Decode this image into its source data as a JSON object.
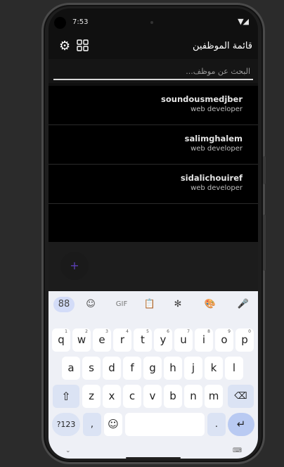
{
  "status_bar": {
    "time": "7:53",
    "signal": "▼◢"
  },
  "app_bar": {
    "title": "قائمة الموظفين",
    "settings_icon": "gear-icon",
    "grid_icon": "grid-icon"
  },
  "search": {
    "placeholder": "البحث عن موظف..."
  },
  "employees": [
    {
      "name": "soundousmedjber",
      "role": "web developer"
    },
    {
      "name": "salimghalem",
      "role": "web developer"
    },
    {
      "name": "sidalichouiref",
      "role": "web developer"
    }
  ],
  "fab": {
    "label": "+"
  },
  "keyboard": {
    "toolbar": [
      "88",
      "☺",
      "GIF",
      "📋",
      "✻",
      "🎨",
      "🎤"
    ],
    "row1": [
      {
        "k": "q",
        "s": "1"
      },
      {
        "k": "w",
        "s": "2"
      },
      {
        "k": "e",
        "s": "3"
      },
      {
        "k": "r",
        "s": "4"
      },
      {
        "k": "t",
        "s": "5"
      },
      {
        "k": "y",
        "s": "6"
      },
      {
        "k": "u",
        "s": "7"
      },
      {
        "k": "i",
        "s": "8"
      },
      {
        "k": "o",
        "s": "9"
      },
      {
        "k": "p",
        "s": "0"
      }
    ],
    "row2": [
      "a",
      "s",
      "d",
      "f",
      "g",
      "h",
      "j",
      "k",
      "l"
    ],
    "row3": [
      "z",
      "x",
      "c",
      "v",
      "b",
      "n",
      "m"
    ],
    "shift": "⇧",
    "backspace": "⌫",
    "symbols": "?123",
    "comma": ",",
    "emoji": "☺",
    "period": ".",
    "enter": "↵",
    "hide": "⌄",
    "keyboard_switch": "⌨"
  },
  "colors": {
    "accent": "#6c4cd1",
    "keyboard_bg": "#eef0f6",
    "screen_bg": "#000000"
  }
}
